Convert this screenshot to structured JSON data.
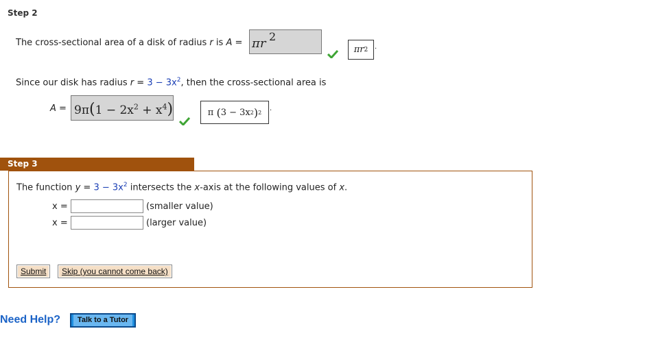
{
  "step2": {
    "title": "Step 2",
    "line1": {
      "prefix": "The cross-sectional area of a disk of radius",
      "r": "r",
      "is": "is",
      "A": "A",
      "eq": "=",
      "answer": "πr",
      "answer_exp": "2",
      "correct": "πr",
      "correct_exp": "2"
    },
    "line2": {
      "prefix": "Since our disk has radius",
      "r": "r",
      "eq": "=",
      "expr_a": "3 − 3x",
      "expr_exp": "2",
      "suffix": ", then the cross-sectional area is"
    },
    "line3": {
      "A": "A",
      "eq": "=",
      "answer_coef": "9π",
      "answer_inner": "1 − 2x",
      "answer_inner_exp": "2",
      "answer_inner_plus": " + x",
      "answer_inner_exp2": "4",
      "correct_pi": "π",
      "correct_inner": "3 − 3x",
      "correct_inner_exp": "2",
      "correct_outer_exp": "2"
    }
  },
  "step3": {
    "title": "Step 3",
    "question": {
      "prefix": "The function",
      "y": "y",
      "eq": "=",
      "expr": "3 − 3x",
      "expr_exp": "2",
      "middle": "intersects the",
      "x_axis_x": "x",
      "axis_suffix": "-axis at the following values of",
      "x": "x",
      "period": "."
    },
    "inputs": [
      {
        "label": "x =",
        "value": "",
        "hint": "(smaller value)"
      },
      {
        "label": "x =",
        "value": "",
        "hint": "(larger value)"
      }
    ],
    "buttons": {
      "submit": "Submit",
      "skip": "Skip (you cannot come back)"
    }
  },
  "help": {
    "need_help": "Need Help?",
    "tutor": "Talk to a Tutor"
  },
  "colors": {
    "step_header": "#a0520d",
    "check": "#3fa535",
    "link_blue": "#1b63c7"
  }
}
